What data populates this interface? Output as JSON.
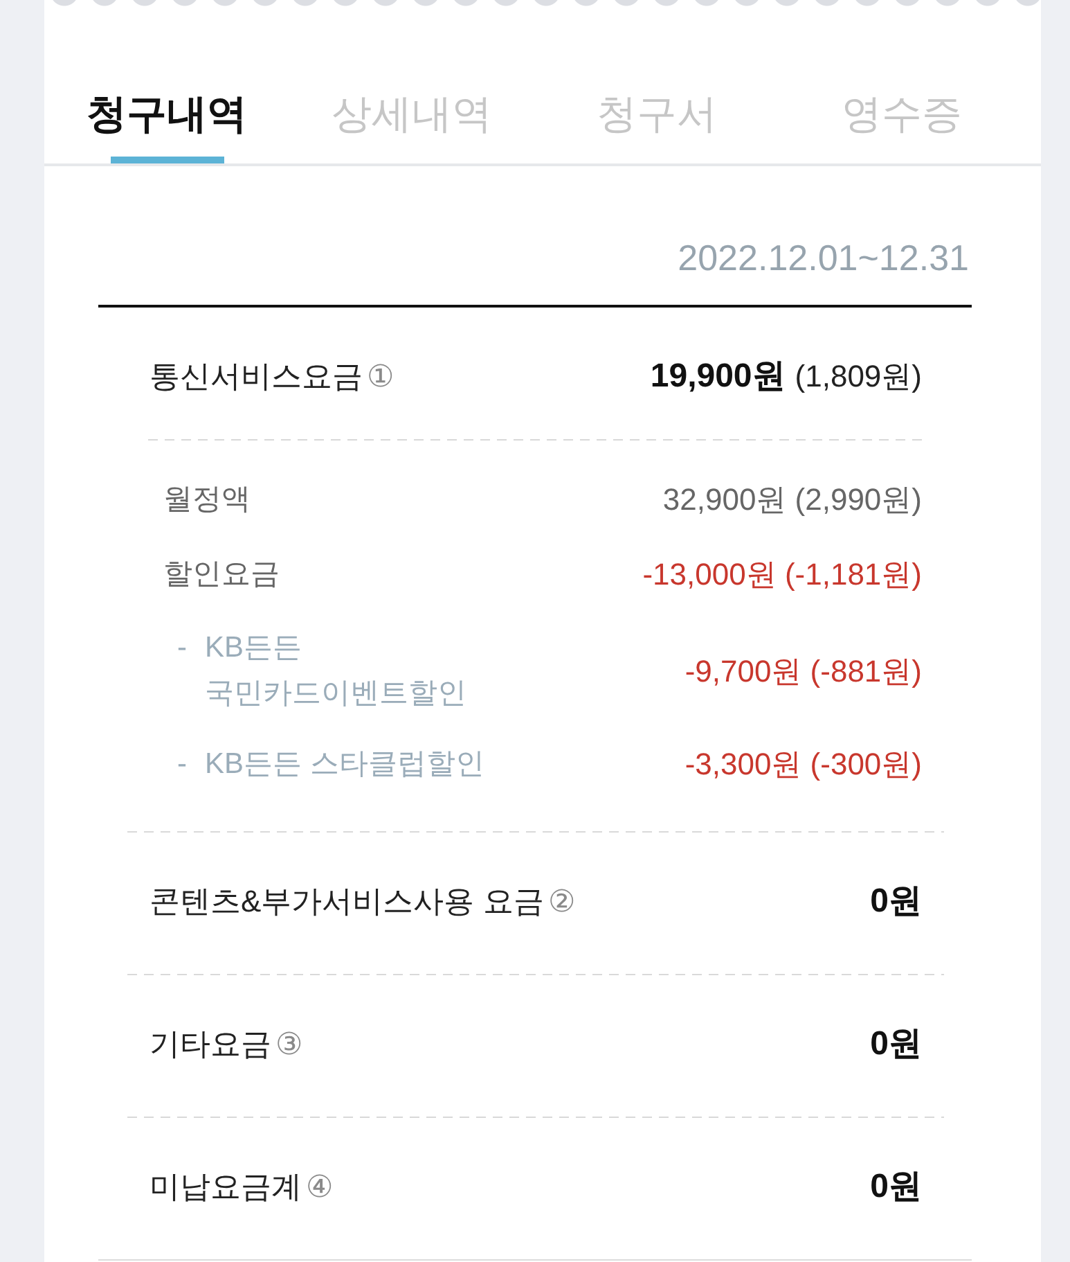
{
  "tabs": [
    {
      "label": "청구내역",
      "selected": true
    },
    {
      "label": "상세내역",
      "selected": false
    },
    {
      "label": "청구서",
      "selected": false
    },
    {
      "label": "영수증",
      "selected": false
    }
  ],
  "period": "2022.12.01~12.31",
  "charges": [
    {
      "label": "통신서비스요금",
      "note": "①",
      "amount": "19,900원",
      "amount_detail": "(1,809원)",
      "items": [
        {
          "kind": "base",
          "label": "월정액",
          "amount": "32,900원 (2,990원)"
        },
        {
          "kind": "discount",
          "label": "할인요금",
          "amount": "-13,000원 (-1,181원)"
        },
        {
          "kind": "discount_item",
          "bullet": "-",
          "label": "KB든든 국민카드이벤트할인",
          "amount": "-9,700원 (-881원)"
        },
        {
          "kind": "discount_item",
          "bullet": "-",
          "label": "KB든든 스타클럽할인",
          "amount": "-3,300원 (-300원)"
        }
      ]
    },
    {
      "label": "콘텐츠&부가서비스사용 요금",
      "note": "②",
      "amount": "0원"
    },
    {
      "label": "기타요금",
      "note": "③",
      "amount": "0원"
    },
    {
      "label": "미납요금계",
      "note": "④",
      "amount": "0원"
    }
  ]
}
